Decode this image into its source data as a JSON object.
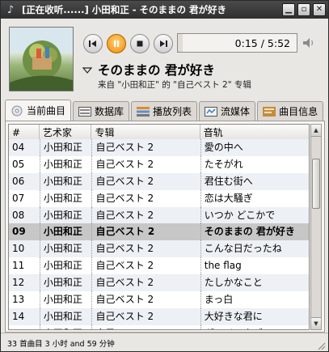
{
  "window": {
    "title": "[正在收听......] 小田和正 - そのままの 君が好き"
  },
  "player": {
    "elapsed": "0:15",
    "total": "5:52",
    "time_separator": " / ",
    "progress_fraction": 0.043
  },
  "now_playing": {
    "title": "そのままの 君が好き",
    "subtitle": "来自 \"小田和正\" 的 \"自己ベスト 2\" 专辑"
  },
  "tabs": [
    {
      "label": "当前曲目",
      "icon": "cd-icon"
    },
    {
      "label": "数据库",
      "icon": "database-icon"
    },
    {
      "label": "播放列表",
      "icon": "playlist-icon"
    },
    {
      "label": "流媒体",
      "icon": "stream-icon"
    },
    {
      "label": "曲目信息",
      "icon": "info-icon"
    }
  ],
  "table": {
    "columns": [
      "#",
      "艺术家",
      "专辑",
      "音轨"
    ],
    "rows": [
      {
        "num": "04",
        "artist": "小田和正",
        "album": "自己ベスト 2",
        "track": "愛の中へ"
      },
      {
        "num": "05",
        "artist": "小田和正",
        "album": "自己ベスト 2",
        "track": "たそがれ"
      },
      {
        "num": "06",
        "artist": "小田和正",
        "album": "自己ベスト 2",
        "track": "君住む街へ"
      },
      {
        "num": "07",
        "artist": "小田和正",
        "album": "自己ベスト 2",
        "track": "恋は大騒ぎ"
      },
      {
        "num": "08",
        "artist": "小田和正",
        "album": "自己ベスト 2",
        "track": "いつか どこかで"
      },
      {
        "num": "09",
        "artist": "小田和正",
        "album": "自己ベスト 2",
        "track": "そのままの 君が好き",
        "playing": true
      },
      {
        "num": "10",
        "artist": "小田和正",
        "album": "自己ベスト 2",
        "track": "こんな日だったね"
      },
      {
        "num": "11",
        "artist": "小田和正",
        "album": "自己ベスト 2",
        "track": "the flag"
      },
      {
        "num": "12",
        "artist": "小田和正",
        "album": "自己ベスト 2",
        "track": "たしかなこと"
      },
      {
        "num": "13",
        "artist": "小田和正",
        "album": "自己ベスト 2",
        "track": "まっ白"
      },
      {
        "num": "14",
        "artist": "小田和正",
        "album": "自己ベスト 2",
        "track": "大好きな君に"
      },
      {
        "num": "15",
        "artist": "小田和正",
        "album": "自己ベスト 2",
        "track": "ダイジョウブ"
      }
    ]
  },
  "status": {
    "text": "33 首曲目 3 小时 and 59 分钟"
  },
  "colors": {
    "titlebar": "#3a3a3a",
    "play_button": "#f08a00",
    "playing_row": "#c7c7c7",
    "alt_row": "#edf1f5"
  }
}
